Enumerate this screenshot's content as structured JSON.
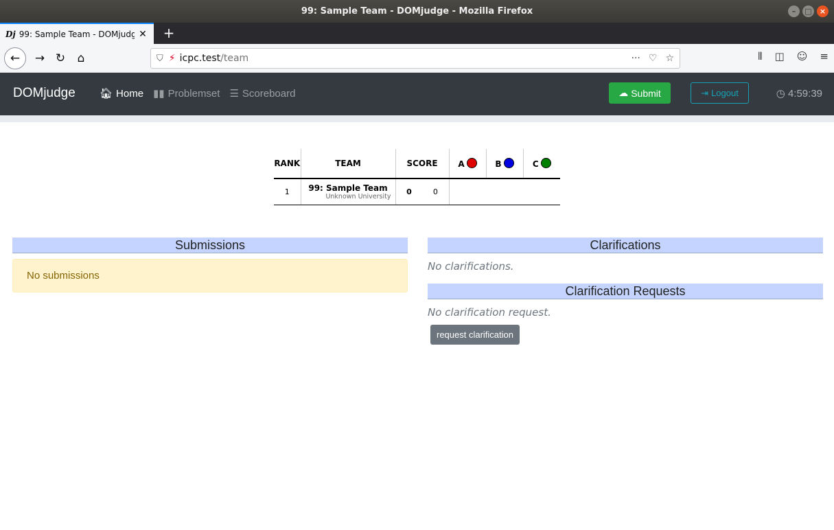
{
  "window": {
    "title": "99: Sample Team - DOMjudge - Mozilla Firefox"
  },
  "browser": {
    "tab_title": "99: Sample Team - DOMjudge",
    "favicon_text": "Dj",
    "url_host": "icpc.test",
    "url_path": "/team"
  },
  "header": {
    "brand": "DOMjudge",
    "nav": [
      {
        "label": "Home",
        "active": true
      },
      {
        "label": "Problemset",
        "active": false
      },
      {
        "label": "Scoreboard",
        "active": false
      }
    ],
    "submit_label": "Submit",
    "logout_label": "Logout",
    "clock": "4:59:39"
  },
  "scoreboard": {
    "headers": {
      "rank": "RANK",
      "team": "TEAM",
      "score": "SCORE"
    },
    "problems": [
      {
        "label": "A",
        "color": "#e00000"
      },
      {
        "label": "B",
        "color": "#0000e0"
      },
      {
        "label": "C",
        "color": "#008000"
      }
    ],
    "row": {
      "rank": "1",
      "team_name": "99: Sample Team",
      "affiliation": "Unknown University",
      "points": "0",
      "penalty": "0"
    }
  },
  "submissions": {
    "title": "Submissions",
    "empty_text": "No submissions"
  },
  "clarifications": {
    "title": "Clarifications",
    "empty_text": "No clarifications."
  },
  "clarification_requests": {
    "title": "Clarification Requests",
    "empty_text": "No clarification request.",
    "button_label": "request clarification"
  }
}
